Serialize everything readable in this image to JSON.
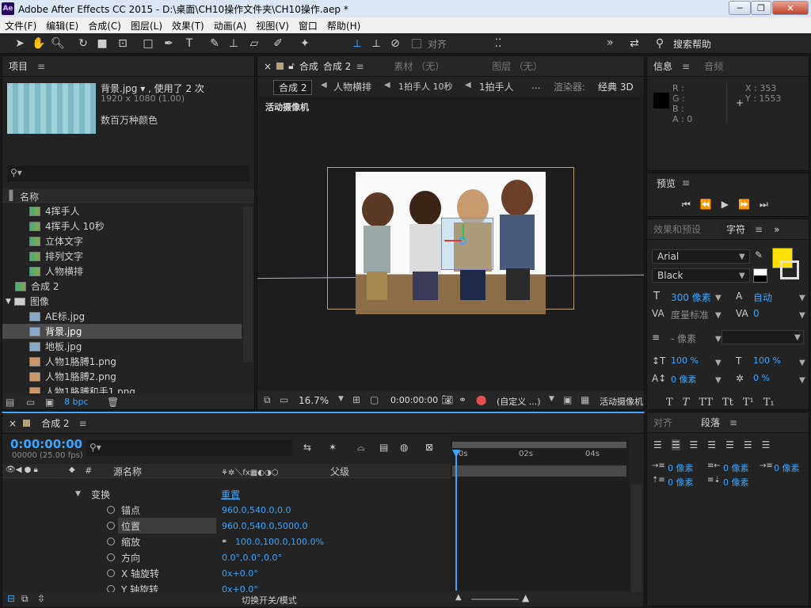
{
  "window": {
    "title": "Adobe After Effects CC 2015 - D:\\桌面\\CH10操作文件夹\\CH10操作.aep *",
    "app_icon": "Ae"
  },
  "menu": [
    "文件(F)",
    "编辑(E)",
    "合成(C)",
    "图层(L)",
    "效果(T)",
    "动画(A)",
    "视图(V)",
    "窗口",
    "帮助(H)"
  ],
  "toolbar": {
    "align_label": "对齐",
    "search_help": "搜索帮助",
    "more": "»"
  },
  "project": {
    "tab": "项目",
    "selected_name": "背景.jpg ▾ , 使用了 2 次",
    "selected_dims": "1920 x 1080 (1.00)",
    "selected_colors": "数百万种颜色",
    "search_placeholder": "",
    "col_name": "名称",
    "items": [
      {
        "label": "4挥手人",
        "type": "comp",
        "indent": 2
      },
      {
        "label": "4挥手人 10秒",
        "type": "comp",
        "indent": 2
      },
      {
        "label": "立体文字",
        "type": "comp",
        "indent": 2
      },
      {
        "label": "排列文字",
        "type": "comp",
        "indent": 2
      },
      {
        "label": "人物横排",
        "type": "comp",
        "indent": 2
      },
      {
        "label": "合成 2",
        "type": "comp",
        "indent": 1
      },
      {
        "label": "图像",
        "type": "folder",
        "indent": 0
      },
      {
        "label": "AE标.jpg",
        "type": "img",
        "indent": 2
      },
      {
        "label": "背景.jpg",
        "type": "img",
        "indent": 2
      },
      {
        "label": "地板.jpg",
        "type": "img",
        "indent": 2
      },
      {
        "label": "人物1胳膊1.png",
        "type": "png",
        "indent": 2
      },
      {
        "label": "人物1胳膊2.png",
        "type": "png",
        "indent": 2
      },
      {
        "label": "人物1胳膊和手1.png",
        "type": "png",
        "indent": 2
      }
    ],
    "bpc": "8 bpc"
  },
  "comp_viewer": {
    "tabs": [
      "合成",
      "合成 2",
      "素材 （无）",
      "图层 （无）"
    ],
    "breadcrumbs": [
      "合成 2",
      "人物横排",
      "1拍手人 10秒",
      "1拍手人",
      "..."
    ],
    "renderer_label": "渲染器:",
    "renderer_value": "经典 3D",
    "active_camera": "活动摄像机",
    "zoom": "16.7%",
    "timecode": "0:00:00:00",
    "custom": "(自定义 ...)",
    "camera_select": "活动摄像机"
  },
  "info": {
    "tab": "信息",
    "tab2": "音频",
    "r": "R :",
    "g": "G :",
    "b": "B :",
    "a": "A : 0",
    "x": "X : 353",
    "y": "Y : 1553"
  },
  "preview": {
    "tab": "预览"
  },
  "character": {
    "tab1": "效果和预设",
    "tab2": "字符",
    "font": "Arial",
    "style": "Black",
    "size": "300 像素",
    "leading": "自动",
    "kerning": "度量标准",
    "tracking": "0",
    "stroke": "- 像素",
    "vscale": "100 %",
    "hscale": "100 %",
    "baseline": "0 像素",
    "tsume": "0 %",
    "fill_color": "#FFE000"
  },
  "paragraph": {
    "tab1": "对齐",
    "tab2": "段落",
    "indent_left": "0 像素",
    "indent_right": "0 像素",
    "indent_first": "0 像素",
    "space_before": "0 像素",
    "space_after": "0 像素"
  },
  "timeline": {
    "tab": "合成 2",
    "timecode": "0:00:00:00",
    "fps": "00000 (25.00 fps)",
    "col_source": "源名称",
    "col_parent": "父级",
    "transform": "变换",
    "reset": "重置",
    "props": [
      {
        "name": "锚点",
        "value": "960.0,540.0,0.0"
      },
      {
        "name": "位置",
        "value": "960.0,540.0,5000.0"
      },
      {
        "name": "缩放",
        "value": "100.0,100.0,100.0%"
      },
      {
        "name": "方向",
        "value": "0.0°,0.0°,0.0°"
      },
      {
        "name": "X 轴旋转",
        "value": "0x+0.0°"
      },
      {
        "name": "Y 轴旋转",
        "value": "0x+0.0°"
      }
    ],
    "ruler": [
      "0s",
      "02s",
      "04s"
    ],
    "footer": "切换开关/模式"
  }
}
